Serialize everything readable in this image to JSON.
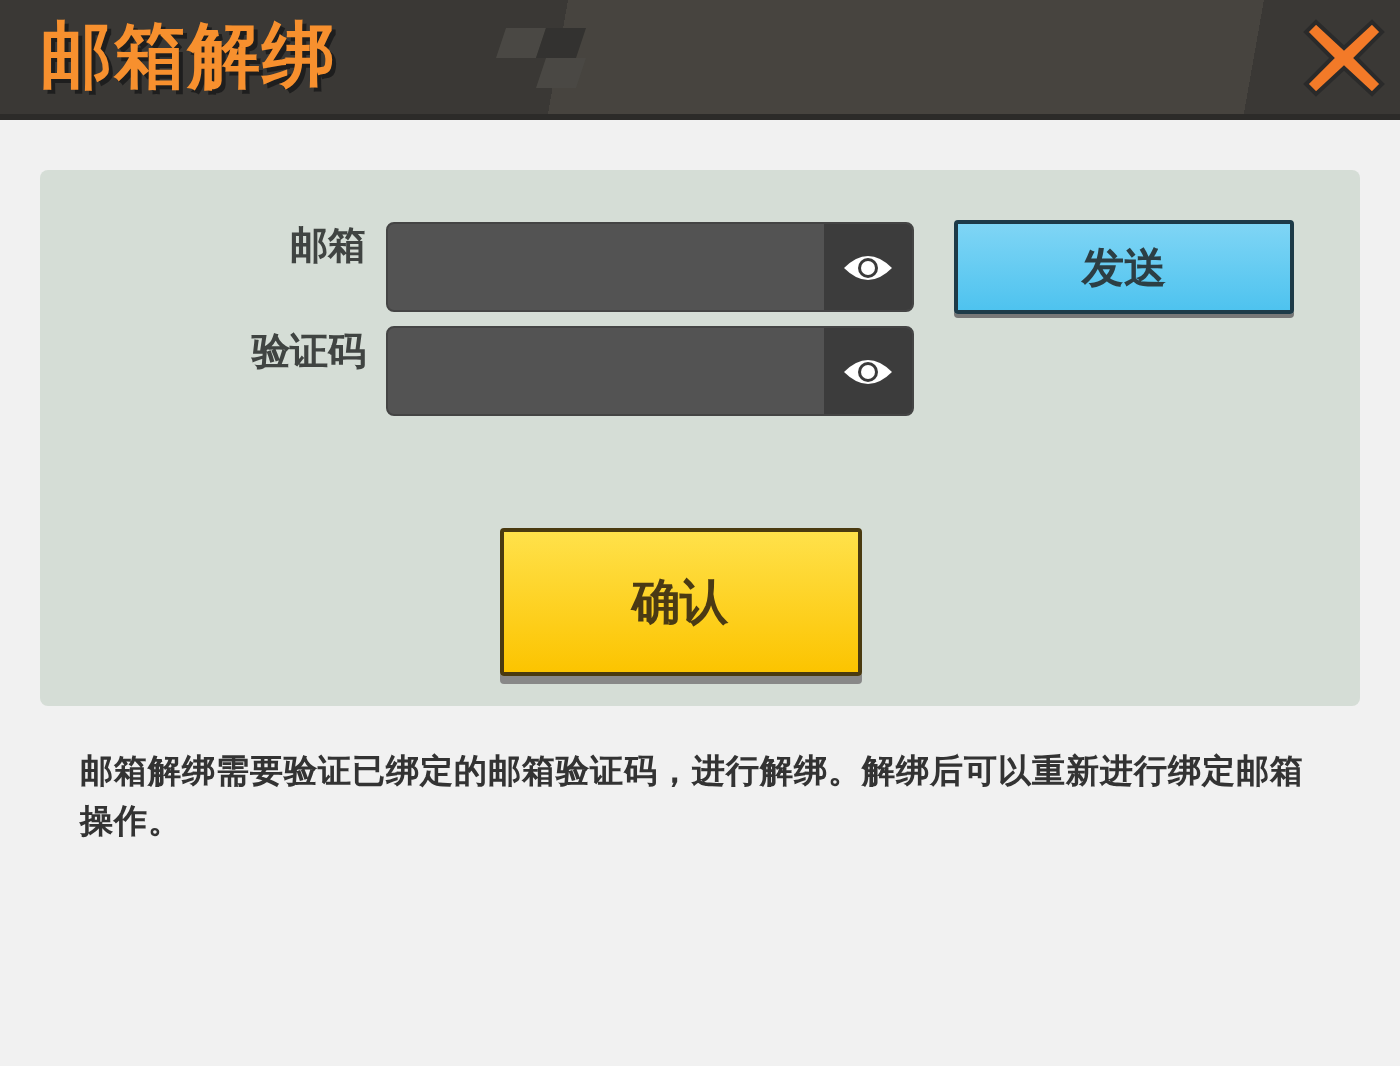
{
  "window": {
    "title": "邮箱解绑"
  },
  "form": {
    "fields": [
      {
        "label": "邮箱"
      },
      {
        "label": "验证码"
      }
    ],
    "send_button": "发送",
    "confirm_button": "确认"
  },
  "description": "邮箱解绑需要验证已绑定的邮箱验证码，进行解绑。解绑后可以重新进行绑定邮箱操作。"
}
